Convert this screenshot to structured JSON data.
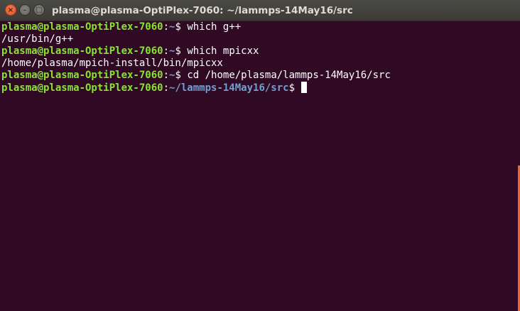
{
  "window": {
    "title": "plasma@plasma-OptiPlex-7060: ~/lammps-14May16/src",
    "close_glyph": "×",
    "minimize_glyph": "–",
    "maximize_glyph": "□"
  },
  "terminal": {
    "lines": [
      {
        "user": "plasma@plasma-OptiPlex-7060",
        "sep": ":",
        "path": "~",
        "prompt": "$",
        "command": " which g++"
      },
      {
        "output": "/usr/bin/g++"
      },
      {
        "user": "plasma@plasma-OptiPlex-7060",
        "sep": ":",
        "path": "~",
        "prompt": "$",
        "command": " which mpicxx"
      },
      {
        "output": "/home/plasma/mpich-install/bin/mpicxx"
      },
      {
        "user": "plasma@plasma-OptiPlex-7060",
        "sep": ":",
        "path": "~",
        "prompt": "$",
        "command": " cd /home/plasma/lammps-14May16/src"
      },
      {
        "user": "plasma@plasma-OptiPlex-7060",
        "sep": ":",
        "path": "~/lammps-14May16/src",
        "prompt": "$",
        "command": " "
      }
    ]
  },
  "colors": {
    "background": "#300a24",
    "user_host": "#8ae234",
    "path": "#729fcf",
    "text": "#ffffff",
    "scrollbar": "#e9672f",
    "close_button": "#e0542b"
  },
  "icons": [
    "close-icon",
    "minimize-icon",
    "maximize-icon"
  ]
}
